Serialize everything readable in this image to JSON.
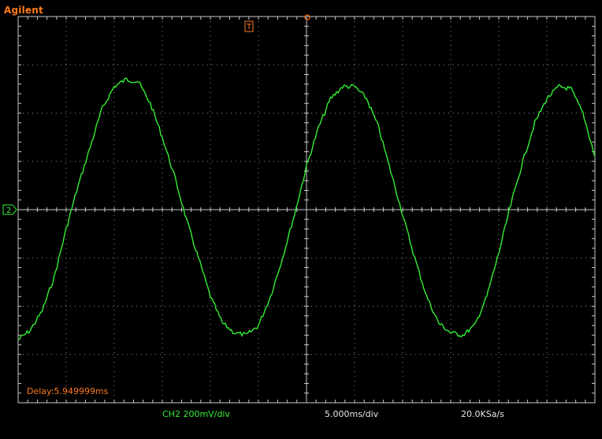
{
  "header": {
    "brand": "Agilent"
  },
  "channel": {
    "id": "2",
    "scale": "CH2 200mV/div"
  },
  "timebase": {
    "scale": "5.000ms/div",
    "sample_rate": "20.0KSa/s",
    "delay": "Delay:5.949999ms"
  },
  "trigger": {
    "label": "T"
  },
  "colors": {
    "brand": "#ff7a1a",
    "trace": "#33ee33",
    "grid": "#8c8c8c",
    "graticule_frame": "#c8c8c8",
    "text": "#e6e6e6"
  },
  "chart_data": {
    "type": "line",
    "title": "",
    "xlabel": "",
    "ylabel": "",
    "series": [
      {
        "x": [
          0.0,
          1.25,
          2.5,
          3.75,
          5.0,
          6.25,
          7.5,
          8.75,
          10.0,
          11.25,
          12.5,
          13.75,
          15.0,
          16.25,
          17.5,
          18.75,
          20.0,
          21.25,
          22.5,
          23.75,
          25.0,
          26.25,
          27.5,
          28.75,
          30.0,
          31.25,
          32.5,
          33.75,
          35.0,
          36.25,
          37.5,
          38.75,
          40.0,
          41.25,
          42.5,
          43.75,
          45.0,
          46.25,
          47.5,
          48.75,
          50.0,
          51.25,
          52.5,
          53.75,
          55.0,
          56.25,
          57.5,
          58.75,
          60.0
        ],
        "values": [
          -0.54,
          -0.5,
          -0.42,
          -0.28,
          -0.08,
          0.1,
          0.26,
          0.42,
          0.51,
          0.54,
          0.53,
          0.44,
          0.3,
          0.14,
          -0.04,
          -0.2,
          -0.36,
          -0.47,
          -0.51,
          -0.52,
          -0.48,
          -0.36,
          -0.2,
          -0.02,
          0.18,
          0.34,
          0.46,
          0.51,
          0.51,
          0.46,
          0.34,
          0.16,
          -0.02,
          -0.2,
          -0.36,
          -0.47,
          -0.51,
          -0.52,
          -0.48,
          -0.36,
          -0.18,
          0.02,
          0.2,
          0.36,
          0.46,
          0.51,
          0.5,
          0.4,
          0.22
        ]
      }
    ],
    "xlim": [
      0,
      60
    ],
    "ylim": [
      -0.8,
      0.8
    ],
    "grid": true
  }
}
